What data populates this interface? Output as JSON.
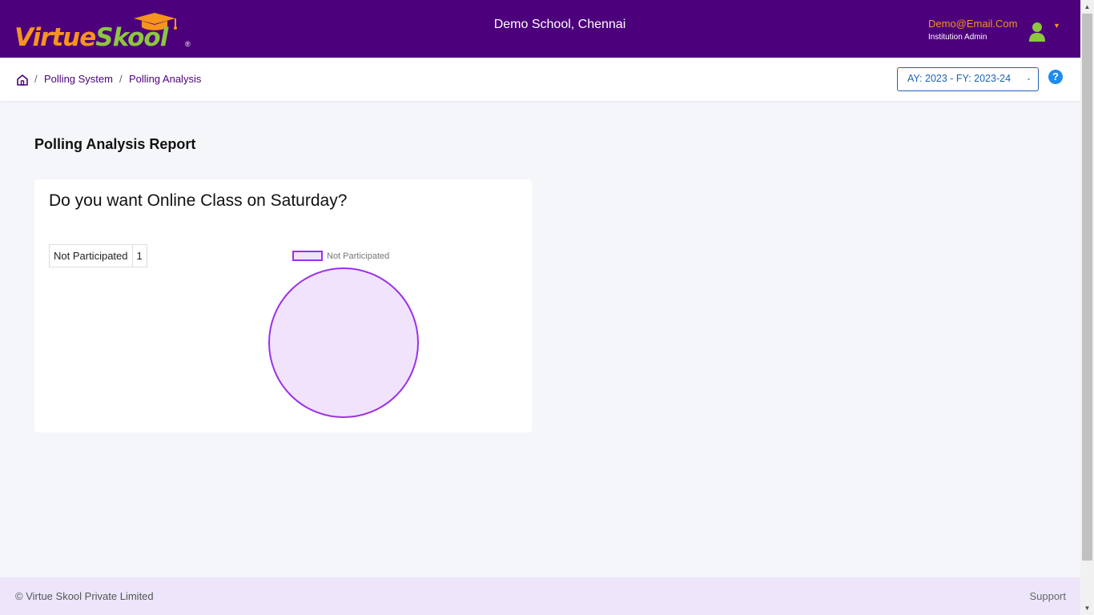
{
  "brand": {
    "logo_part1": "Virtue",
    "logo_part2": "Skool",
    "registered_mark": "®"
  },
  "header": {
    "school_name": "Demo School, Chennai",
    "user_email": "Demo@Email.Com",
    "user_role": "Institution Admin"
  },
  "breadcrumb": {
    "separator": "/",
    "items": [
      {
        "label": "Polling System"
      },
      {
        "label": "Polling Analysis"
      }
    ]
  },
  "year_selector": {
    "selected": "AY: 2023 - FY: 2023-24"
  },
  "help": {
    "label": "?"
  },
  "page": {
    "title": "Polling Analysis Report"
  },
  "poll": {
    "question": "Do you want Online Class on Saturday?",
    "results": [
      {
        "label": "Not Participated",
        "count": "1"
      }
    ]
  },
  "chart_data": {
    "type": "pie",
    "labels": [
      "Not Participated"
    ],
    "values": [
      1
    ],
    "legend_position": "top",
    "colors": {
      "fill": "#f1e3fb",
      "border": "#9b30ec"
    }
  },
  "footer": {
    "copyright": "© Virtue Skool Private Limited",
    "support": "Support"
  },
  "theme": {
    "header_bg": "#4c007c",
    "accent_orange": "#f7941d",
    "accent_green": "#8dc63f",
    "link_blue": "#1d63b4",
    "footer_bg": "#ede6fb"
  }
}
